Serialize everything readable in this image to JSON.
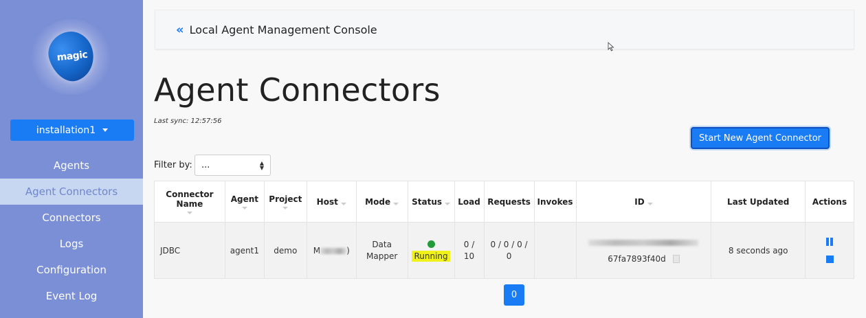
{
  "sidebar": {
    "logo_text": "magic",
    "installation_label": "installation1",
    "items": [
      {
        "label": "Agents"
      },
      {
        "label": "Agent Connectors"
      },
      {
        "label": "Connectors"
      },
      {
        "label": "Logs"
      },
      {
        "label": "Configuration"
      },
      {
        "label": "Event Log"
      }
    ],
    "active_index": 1
  },
  "header": {
    "collapse_glyph": "«",
    "title": "Local Agent Management Console"
  },
  "main": {
    "title": "Agent Connectors",
    "last_sync": "Last sync: 12:57:56",
    "start_button": "Start New Agent Connector",
    "filter_label": "Filter by:",
    "filter_value": "..."
  },
  "table": {
    "headers": [
      "Connector Name",
      "Agent",
      "Project",
      "Host",
      "Mode",
      "Status",
      "Load",
      "Requests",
      "Invokes",
      "ID",
      "Last Updated",
      "Actions"
    ],
    "rows": [
      {
        "connector_name": "JDBC",
        "agent": "agent1",
        "project": "demo",
        "host_prefix": "M",
        "host_suffix": ")",
        "mode": "Data Mapper",
        "status": "Running",
        "load": "0 / 10",
        "requests": "0 / 0 / 0 / 0",
        "invokes": "",
        "id_suffix": "67fa7893f40d",
        "last_updated": "8 seconds ago"
      }
    ]
  },
  "pagination": {
    "current": "0"
  },
  "colors": {
    "sidebar_bg": "#7b8fd6",
    "primary": "#1a7cf5",
    "status_running": "#239b3a",
    "highlight": "#f2f21b"
  }
}
